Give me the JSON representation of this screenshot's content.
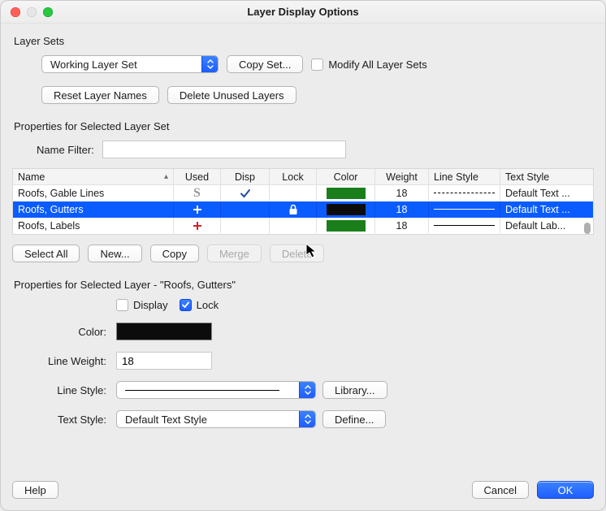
{
  "window": {
    "title": "Layer Display Options"
  },
  "layer_sets": {
    "label": "Layer Sets",
    "dropdown_value": "Working Layer Set",
    "copy_set": "Copy Set...",
    "modify_all_label": "Modify All Layer Sets",
    "modify_all_checked": false,
    "reset_names": "Reset Layer Names",
    "delete_unused": "Delete Unused Layers"
  },
  "selected_set": {
    "heading": "Properties for Selected Layer Set",
    "name_filter_label": "Name Filter:",
    "name_filter_value": "",
    "columns": {
      "name": "Name",
      "used": "Used",
      "disp": "Disp",
      "lock": "Lock",
      "color": "Color",
      "weight": "Weight",
      "line_style": "Line Style",
      "text_style": "Text Style"
    },
    "rows": [
      {
        "name": "Roofs, Gable Lines",
        "used": "S",
        "disp": "check",
        "lock": "",
        "color": "#1a7f1a",
        "weight": "18",
        "line_style": "dash",
        "text_style": "Default Text ...",
        "selected": false
      },
      {
        "name": "Roofs, Gutters",
        "used": "plus",
        "disp": "",
        "lock": "lock",
        "color": "#0c0c0c",
        "weight": "18",
        "line_style": "solid",
        "text_style": "Default Text ...",
        "selected": true
      },
      {
        "name": "Roofs, Labels",
        "used": "plus-red",
        "disp": "",
        "lock": "",
        "color": "#1a7f1a",
        "weight": "18",
        "line_style": "solid",
        "text_style": "Default Lab...",
        "selected": false
      }
    ],
    "buttons": {
      "select_all": "Select All",
      "new": "New...",
      "copy": "Copy",
      "merge": "Merge",
      "delete": "Delete"
    }
  },
  "selected_layer": {
    "heading": "Properties for Selected Layer - \"Roofs, Gutters\"",
    "display_label": "Display",
    "display_checked": false,
    "lock_label": "Lock",
    "lock_checked": true,
    "color_label": "Color:",
    "color_value": "#0c0c0c",
    "line_weight_label": "Line Weight:",
    "line_weight_value": "18",
    "line_style_label": "Line Style:",
    "line_style_value": "solid",
    "library_btn": "Library...",
    "text_style_label": "Text Style:",
    "text_style_value": "Default Text Style",
    "define_btn": "Define..."
  },
  "footer": {
    "help": "Help",
    "cancel": "Cancel",
    "ok": "OK"
  }
}
